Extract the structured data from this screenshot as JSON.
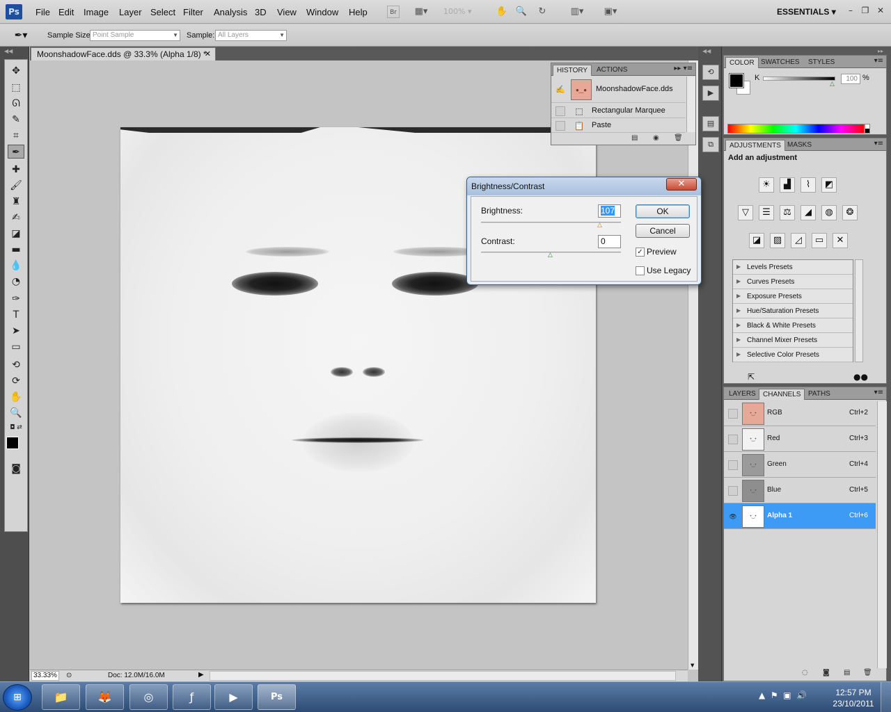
{
  "app": {
    "logo": "Ps",
    "workspace": "ESSENTIALS",
    "zoom_level": "100%"
  },
  "menu": [
    "File",
    "Edit",
    "Image",
    "Layer",
    "Select",
    "Filter",
    "Analysis",
    "3D",
    "View",
    "Window",
    "Help"
  ],
  "options_bar": {
    "sample_size_label": "Sample Size:",
    "sample_size_value": "Point Sample",
    "sample_label": "Sample:",
    "sample_value": "All Layers"
  },
  "document": {
    "tab_title": "MoonshadowFace.dds @ 33.3% (Alpha 1/8) *",
    "status_zoom": "33.33%",
    "status_doc": "Doc: 12.0M/16.0M"
  },
  "history_panel": {
    "tabs": [
      "HISTORY",
      "ACTIONS"
    ],
    "snapshot": "MoonshadowFace.dds",
    "steps": [
      "Rectangular Marquee",
      "Paste"
    ]
  },
  "color_panel": {
    "tabs": [
      "COLOR",
      "SWATCHES",
      "STYLES"
    ],
    "channel_label": "K",
    "channel_value": "100",
    "unit": "%"
  },
  "adjustments_panel": {
    "tabs": [
      "ADJUSTMENTS",
      "MASKS"
    ],
    "title": "Add an adjustment",
    "presets": [
      "Levels Presets",
      "Curves Presets",
      "Exposure Presets",
      "Hue/Saturation Presets",
      "Black & White Presets",
      "Channel Mixer Presets",
      "Selective Color Presets"
    ]
  },
  "channels_panel": {
    "tabs": [
      "LAYERS",
      "CHANNELS",
      "PATHS"
    ],
    "channels": [
      {
        "name": "RGB",
        "shortcut": "Ctrl+2"
      },
      {
        "name": "Red",
        "shortcut": "Ctrl+3"
      },
      {
        "name": "Green",
        "shortcut": "Ctrl+4"
      },
      {
        "name": "Blue",
        "shortcut": "Ctrl+5"
      },
      {
        "name": "Alpha 1",
        "shortcut": "Ctrl+6"
      }
    ]
  },
  "dialog": {
    "title": "Brightness/Contrast",
    "brightness_label": "Brightness:",
    "brightness_value": "107",
    "contrast_label": "Contrast:",
    "contrast_value": "0",
    "ok_label": "OK",
    "cancel_label": "Cancel",
    "preview_label": "Preview",
    "preview_checked": true,
    "legacy_label": "Use Legacy",
    "legacy_checked": false
  },
  "taskbar": {
    "time": "12:57 PM",
    "date": "23/10/2011"
  },
  "colors": {
    "accent": "#3d9bf5",
    "toolbox": "#4e4e4e",
    "canvas_bg": "#c4c4c4"
  }
}
